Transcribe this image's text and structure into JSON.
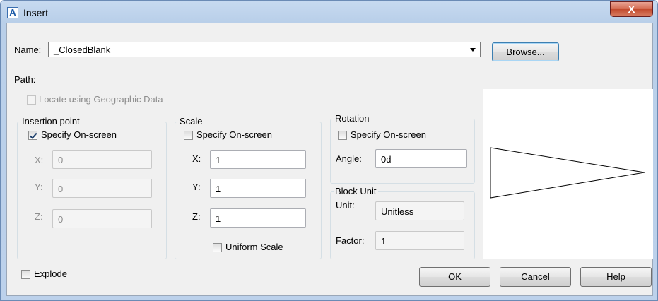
{
  "window": {
    "title": "Insert",
    "close_label": "X",
    "app_icon_letter": "A"
  },
  "name": {
    "label": "Name:",
    "value": "_ClosedBlank",
    "browse_label": "Browse..."
  },
  "path": {
    "label": "Path:"
  },
  "geo": {
    "label": "Locate using Geographic Data",
    "checked": false,
    "enabled": false
  },
  "insertion_point": {
    "title": "Insertion point",
    "specify_label": "Specify On-screen",
    "specify_checked": true,
    "x_label": "X:",
    "x_value": "0",
    "y_label": "Y:",
    "y_value": "0",
    "z_label": "Z:",
    "z_value": "0"
  },
  "scale": {
    "title": "Scale",
    "specify_label": "Specify On-screen",
    "specify_checked": false,
    "x_label": "X:",
    "x_value": "1",
    "y_label": "Y:",
    "y_value": "1",
    "z_label": "Z:",
    "z_value": "1",
    "uniform_label": "Uniform Scale",
    "uniform_checked": false
  },
  "rotation": {
    "title": "Rotation",
    "specify_label": "Specify On-screen",
    "specify_checked": false,
    "angle_label": "Angle:",
    "angle_value": "0d"
  },
  "block_unit": {
    "title": "Block Unit",
    "unit_label": "Unit:",
    "unit_value": "Unitless",
    "factor_label": "Factor:",
    "factor_value": "1"
  },
  "explode": {
    "label": "Explode",
    "checked": false
  },
  "buttons": {
    "ok": "OK",
    "cancel": "Cancel",
    "help": "Help"
  },
  "colors": {
    "title_bar": "#bcd1eb",
    "dialog_bg": "#f0f0f0",
    "close_button": "#c24a2e"
  },
  "icons": {
    "app": "autocad-icon",
    "close": "close-icon",
    "dropdown": "chevron-down-icon"
  }
}
